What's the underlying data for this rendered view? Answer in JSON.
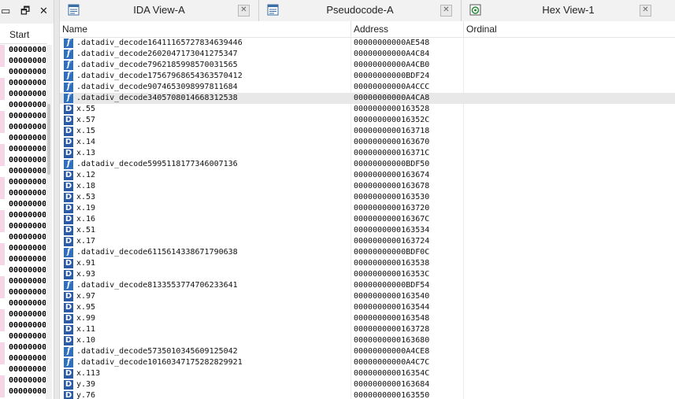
{
  "left_toolbar": {
    "minimize": "▭",
    "restore": "🗗",
    "close": "✕"
  },
  "left_pane": {
    "header": "Start",
    "rows": [
      "00000000",
      "00000000",
      "00000000",
      "00000000",
      "00000000",
      "00000000",
      "00000000",
      "00000000",
      "00000000",
      "00000000",
      "00000000",
      "00000000",
      "00000000",
      "00000000",
      "00000000",
      "00000000",
      "00000000",
      "00000000",
      "00000000",
      "00000000",
      "00000000",
      "00000000",
      "00000000",
      "00000000",
      "00000000",
      "00000000",
      "00000000",
      "00000000",
      "00000000",
      "00000000",
      "00000000",
      "00000000"
    ]
  },
  "tabs": [
    {
      "label": "IDA View-A",
      "icon": "ida-view-icon"
    },
    {
      "label": "Pseudocode-A",
      "icon": "pseudocode-icon"
    },
    {
      "label": "Hex View-1",
      "icon": "hex-view-icon"
    }
  ],
  "table": {
    "columns": [
      "Name",
      "Address",
      "Ordinal"
    ],
    "selected_index": 5,
    "rows": [
      {
        "type": "f",
        "name": ".datadiv_decode16411165727834639446",
        "address": "00000000000AE548"
      },
      {
        "type": "f",
        "name": ".datadiv_decode2602047173041275347",
        "address": "00000000000A4C84"
      },
      {
        "type": "f",
        "name": ".datadiv_decode7962185998570031565",
        "address": "00000000000A4CB0"
      },
      {
        "type": "f",
        "name": ".datadiv_decode17567968654363570412",
        "address": "00000000000BDF24"
      },
      {
        "type": "f",
        "name": ".datadiv_decode9074653098997811684",
        "address": "00000000000A4CCC"
      },
      {
        "type": "f",
        "name": ".datadiv_decode3405708014668312538",
        "address": "00000000000A4CA8"
      },
      {
        "type": "D",
        "name": "x.55",
        "address": "0000000000163528"
      },
      {
        "type": "D",
        "name": "x.57",
        "address": "000000000016352C"
      },
      {
        "type": "D",
        "name": "x.15",
        "address": "0000000000163718"
      },
      {
        "type": "D",
        "name": "x.14",
        "address": "0000000000163670"
      },
      {
        "type": "D",
        "name": "x.13",
        "address": "000000000016371C"
      },
      {
        "type": "f",
        "name": ".datadiv_decode5995118177346007136",
        "address": "00000000000BDF50"
      },
      {
        "type": "D",
        "name": "x.12",
        "address": "0000000000163674"
      },
      {
        "type": "D",
        "name": "x.18",
        "address": "0000000000163678"
      },
      {
        "type": "D",
        "name": "x.53",
        "address": "0000000000163530"
      },
      {
        "type": "D",
        "name": "x.19",
        "address": "0000000000163720"
      },
      {
        "type": "D",
        "name": "x.16",
        "address": "000000000016367C"
      },
      {
        "type": "D",
        "name": "x.51",
        "address": "0000000000163534"
      },
      {
        "type": "D",
        "name": "x.17",
        "address": "0000000000163724"
      },
      {
        "type": "f",
        "name": ".datadiv_decode6115614338671790638",
        "address": "00000000000BDF0C"
      },
      {
        "type": "D",
        "name": "x.91",
        "address": "0000000000163538"
      },
      {
        "type": "D",
        "name": "x.93",
        "address": "000000000016353C"
      },
      {
        "type": "f",
        "name": ".datadiv_decode8133553774706233641",
        "address": "00000000000BDF54"
      },
      {
        "type": "D",
        "name": "x.97",
        "address": "0000000000163540"
      },
      {
        "type": "D",
        "name": "x.95",
        "address": "0000000000163544"
      },
      {
        "type": "D",
        "name": "x.99",
        "address": "0000000000163548"
      },
      {
        "type": "D",
        "name": "x.11",
        "address": "0000000000163728"
      },
      {
        "type": "D",
        "name": "x.10",
        "address": "0000000000163680"
      },
      {
        "type": "f",
        "name": ".datadiv_decode5735010345609125042",
        "address": "00000000000A4CE8"
      },
      {
        "type": "f",
        "name": ".datadiv_decode10160347175282829921",
        "address": "00000000000A4C7C"
      },
      {
        "type": "D",
        "name": "x.113",
        "address": "000000000016354C"
      },
      {
        "type": "D",
        "name": "y.39",
        "address": "0000000000163684"
      },
      {
        "type": "D",
        "name": "y.76",
        "address": "0000000000163550"
      }
    ]
  }
}
